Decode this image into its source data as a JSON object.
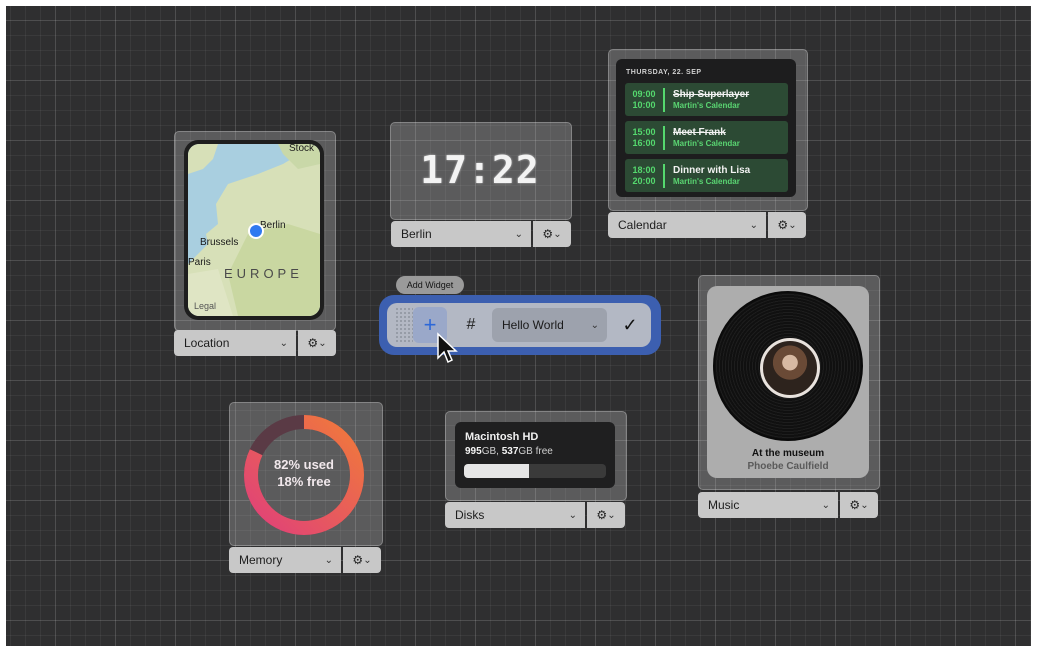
{
  "map_widget": {
    "labels": {
      "stockholm": "Stock",
      "berlin": "Berlin",
      "brussels": "Brussels",
      "paris": "Paris",
      "region": "EUROPE",
      "legal": "Legal"
    },
    "bar": {
      "select": "Location",
      "chevron": "⌄",
      "gear": "⚙",
      "gear_chev": "⌄"
    }
  },
  "clock_widget": {
    "time": "17:22",
    "bar": {
      "select": "Berlin",
      "chevron": "⌄",
      "gear": "⚙",
      "gear_chev": "⌄"
    }
  },
  "calendar_widget": {
    "date": "THURSDAY, 22. SEP",
    "events": [
      {
        "start": "09:00",
        "end": "10:00",
        "title": "Ship Superlayer",
        "calendar": "Martin's Calendar",
        "done": true
      },
      {
        "start": "15:00",
        "end": "16:00",
        "title": "Meet Frank",
        "calendar": "Martin's Calendar",
        "done": true
      },
      {
        "start": "18:00",
        "end": "20:00",
        "title": "Dinner with Lisa",
        "calendar": "Martin's Calendar",
        "done": false
      }
    ],
    "bar": {
      "select": "Calendar",
      "chevron": "⌄",
      "gear": "⚙",
      "gear_chev": "⌄"
    }
  },
  "add_widget": {
    "label": "Add Widget",
    "add_icon": "+",
    "grid_icon": "#",
    "select": "Hello World",
    "chevron": "⌄",
    "confirm": "✓"
  },
  "memory_widget": {
    "used": "82% used",
    "free": "18% free",
    "used_fraction": 0.82,
    "bar": {
      "select": "Memory",
      "chevron": "⌄",
      "gear": "⚙",
      "gear_chev": "⌄"
    }
  },
  "disk_widget": {
    "name": "Macintosh HD",
    "total_num": "995",
    "total_unit": "GB, ",
    "free_num": "537",
    "free_unit": "GB free",
    "used_fraction": 0.46,
    "bar": {
      "select": "Disks",
      "chevron": "⌄",
      "gear": "⚙",
      "gear_chev": "⌄"
    }
  },
  "music_widget": {
    "title": "At the museum",
    "artist": "Phoebe Caulfield",
    "bar": {
      "select": "Music",
      "chevron": "⌄",
      "gear": "⚙",
      "gear_chev": "⌄"
    }
  },
  "colors": {
    "calendar_green": "#55d96e",
    "accent_blue": "#2c67d8",
    "memory_ring_start": "#e0407a",
    "memory_ring_end": "#f07a3a"
  }
}
